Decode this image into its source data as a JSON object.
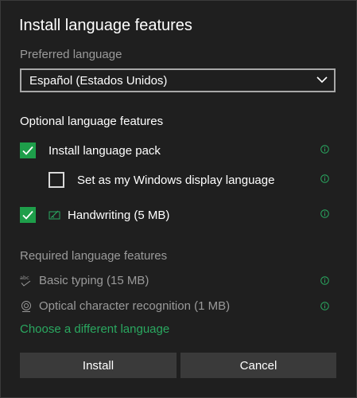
{
  "dialog": {
    "title": "Install language features"
  },
  "preferred": {
    "label": "Preferred language",
    "selected": "Español (Estados Unidos)"
  },
  "optional": {
    "heading": "Optional language features",
    "items": [
      {
        "label": "Install language pack",
        "checked": true
      },
      {
        "label": "Set as my Windows display language",
        "checked": false
      },
      {
        "label": "Handwriting (5 MB)",
        "checked": true
      }
    ]
  },
  "required": {
    "heading": "Required language features",
    "items": [
      {
        "label": "Basic typing (15 MB)",
        "icon": "basic-typing-icon"
      },
      {
        "label": "Optical character recognition (1 MB)",
        "icon": "ocr-icon"
      }
    ]
  },
  "link": {
    "label": "Choose a different language"
  },
  "buttons": {
    "install": "Install",
    "cancel": "Cancel"
  },
  "icons": {
    "abc": "abc"
  },
  "colors": {
    "background": "#1f1f1f",
    "accent": "#1e9e4a",
    "link": "#2aa860",
    "button": "#3a3a3a",
    "muted_text": "#9a9a9a"
  }
}
